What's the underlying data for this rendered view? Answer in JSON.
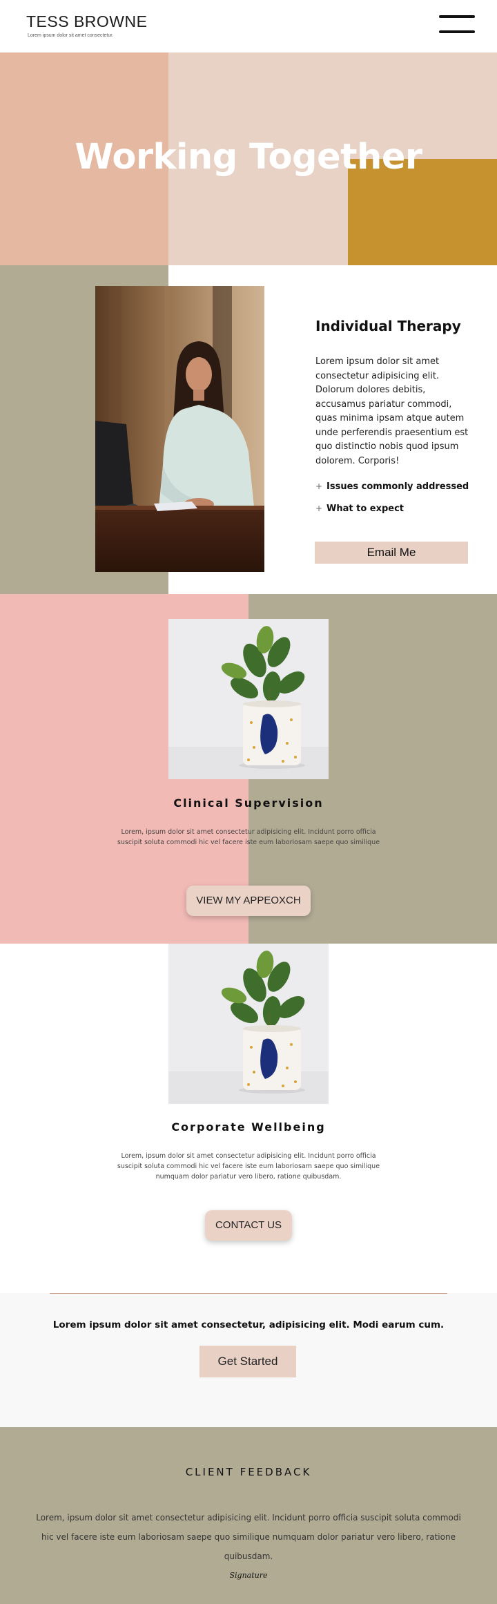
{
  "header": {
    "brand": "TESS BROWNE",
    "tagline": "Lorem ipsum dolor sit amet consectetur."
  },
  "hero": {
    "title": "Working Together"
  },
  "therapy": {
    "title": "Individual Therapy",
    "body": "Lorem ipsum dolor sit amet consectetur adipisicing elit. Dolorum dolores debitis, accusamus pariatur commodi, quas minima ipsam atque autem unde perferendis praesentium est quo distinctio nobis quod ipsum dolorem. Corporis!",
    "accordion": [
      {
        "icon": "plus-icon",
        "label": "Issues commonly addressed"
      },
      {
        "icon": "plus-icon",
        "label": "What to expect"
      }
    ],
    "button_label": "Email Me"
  },
  "clinical": {
    "title": "Clinical Supervision",
    "body": "Lorem, ipsum dolor sit amet consectetur adipisicing elit. Incidunt porro officia suscipit soluta commodi hic vel facere iste eum laboriosam saepe quo similique",
    "button_label": "VIEW MY APPEOXCH"
  },
  "corporate": {
    "title": "Corporate Wellbeing",
    "body": "Lorem, ipsum dolor sit amet consectetur adipisicing elit. Incidunt porro officia suscipit soluta commodi hic vel facere iste eum laboriosam saepe quo similique numquam dolor pariatur vero libero, ratione quibusdam.",
    "button_label": "CONTACT US"
  },
  "cta": {
    "text": "Lorem ipsum dolor sit amet consectetur, adipisicing elit. Modi earum cum.",
    "button_label": "Get Started"
  },
  "feedback": {
    "title": "CLIENT FEEDBACK",
    "body": "Lorem, ipsum dolor sit amet consectetur adipisicing elit. Incidunt porro officia suscipit soluta commodi hic vel facere iste eum laboriosam saepe quo similique numquam dolor pariatur vero libero, ratione quibusdam.",
    "signature": "Signature"
  },
  "colors": {
    "peach": "#e5b9a1",
    "blush": "#e8d2c6",
    "mustard": "#c6922f",
    "olive": "#b1ab94",
    "pink": "#f2bab5",
    "button": "#e8d0c5"
  }
}
